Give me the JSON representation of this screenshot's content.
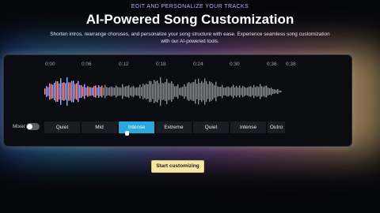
{
  "header": {
    "eyebrow": "EDIT AND PERSONALIZE YOUR TRACKS",
    "title": "AI-Powered Song Customization",
    "subtitle": "Shorten intros, rearrange choruses, and personalize your song structure with ease. Experience seamless song customization with our AI-powered tools."
  },
  "timeline": {
    "ticks": [
      "0:00",
      "0:06",
      "0:12",
      "0:18",
      "0:24",
      "0:30",
      "0:36",
      "0:38"
    ]
  },
  "controls": {
    "mixer_label": "Mixer",
    "mixer_on": false,
    "segments": [
      "Quiet",
      "Mid",
      "Intense",
      "Extreme",
      "Quiet",
      "Intense",
      "Outro"
    ],
    "active_segment": "Intense"
  },
  "cta": {
    "label": "Start customizing"
  },
  "colors": {
    "accent": "#2aa7df",
    "cta_bg": "#f6e7a6",
    "eyebrow": "#b9a8ff"
  }
}
